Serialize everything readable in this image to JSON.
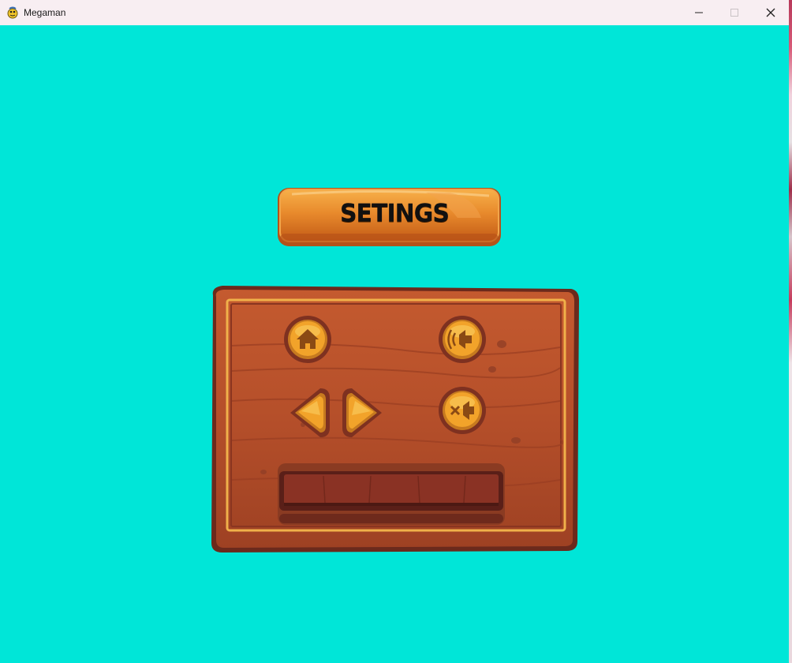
{
  "window": {
    "title": "Megaman",
    "controls": [
      "minimize",
      "maximize",
      "close"
    ]
  },
  "colors": {
    "background": "#00e6d8",
    "titlebar": "#f8eef2",
    "wood_dark": "#8a3b22",
    "wood_mid": "#c0592c",
    "gold": "#f0a828",
    "plank_orange": "#e8862a"
  },
  "settings": {
    "heading": "SETINGS"
  },
  "controls": {
    "home": {
      "icon": "home-icon"
    },
    "sound_on": {
      "icon": "speaker-icon"
    },
    "prev": {
      "icon": "arrow-left-icon"
    },
    "next": {
      "icon": "arrow-right-icon"
    },
    "mute": {
      "icon": "speaker-mute-icon"
    }
  },
  "volume": {
    "level": 0
  }
}
